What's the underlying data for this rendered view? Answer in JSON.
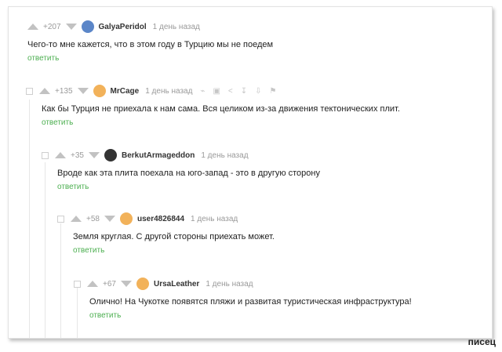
{
  "comments": [
    {
      "rating": "+207",
      "nick": "GalyaPeridol",
      "date": "1 день назад",
      "text": "Чего-то мне кажется, что в этом году в Турцию мы не поедем",
      "reply": "ответить",
      "avatar_color": "#5b86c8"
    },
    {
      "rating": "+135",
      "nick": "MrCage",
      "date": "1 день назад",
      "text": "Как бы Турция не приехала к нам сама. Вся целиком из-за движения тектонических плит.",
      "reply": "ответить",
      "avatar_color": "#f2b25a"
    },
    {
      "rating": "+35",
      "nick": "BerkutArmageddon",
      "date": "1 день назад",
      "text": "Вроде как эта плита поехала на юго-запад - это в другую сторону",
      "reply": "ответить",
      "avatar_color": "#333333"
    },
    {
      "rating": "+58",
      "nick": "user4826844",
      "date": "1 день назад",
      "text": "Земля круглая. С другой стороны приехать может.",
      "reply": "ответить",
      "avatar_color": "#f2b25a"
    },
    {
      "rating": "+67",
      "nick": "UrsaLeather",
      "date": "1 день назад",
      "text": "Олично! На Чукотке появятся пляжи и развитая туристическая инфраструктура!",
      "reply": "ответить",
      "avatar_color": "#f2b25a"
    }
  ],
  "watermark": "писец"
}
